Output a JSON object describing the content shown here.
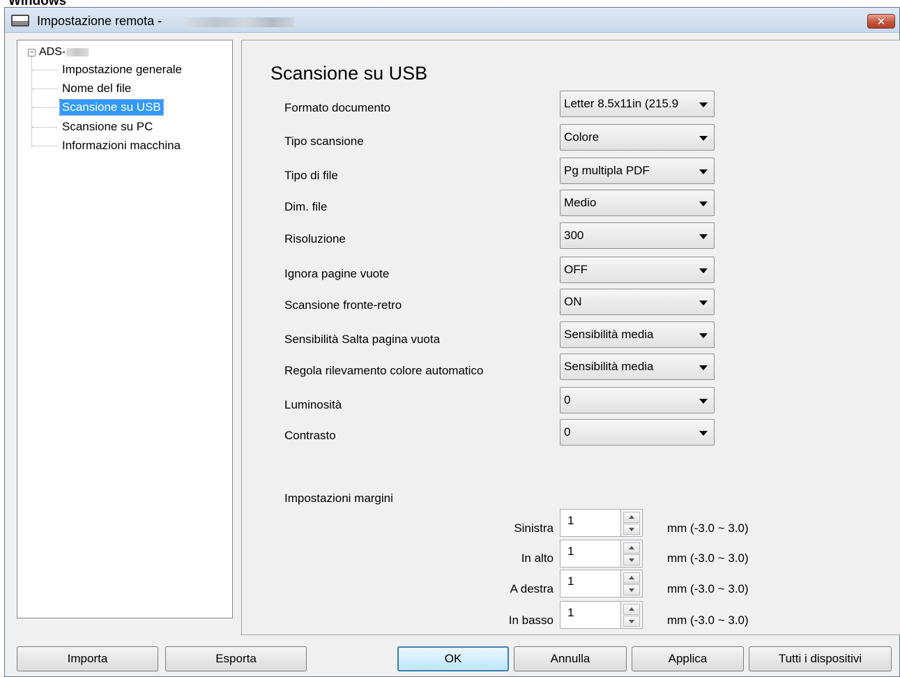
{
  "page": {
    "caption": "Windows"
  },
  "window": {
    "title": "Impostazione remota -",
    "close_icon": "close-icon"
  },
  "tree": {
    "root_label": "ADS-",
    "items": [
      {
        "label": "Impostazione generale"
      },
      {
        "label": "Nome del file"
      },
      {
        "label": "Scansione su USB",
        "selected": true
      },
      {
        "label": "Scansione su PC"
      },
      {
        "label": "Informazioni macchina"
      }
    ]
  },
  "content": {
    "title": "Scansione su USB",
    "settings": [
      {
        "label": "Formato documento",
        "value": "Letter 8.5x11in (215.9"
      },
      {
        "label": "Tipo scansione",
        "value": "Colore"
      },
      {
        "label": "Tipo di file",
        "value": "Pg multipla PDF"
      },
      {
        "label": "Dim. file",
        "value": "Medio"
      },
      {
        "label": "Risoluzione",
        "value": "300"
      },
      {
        "label": "Ignora pagine vuote",
        "value": "OFF"
      },
      {
        "label": "Scansione fronte-retro",
        "value": "ON"
      },
      {
        "label": "Sensibilità Salta pagina vuota",
        "value": "Sensibilità media"
      },
      {
        "label": "Regola rilevamento colore automatico",
        "value": "Sensibilità media"
      },
      {
        "label": "Luminosità",
        "value": "0"
      },
      {
        "label": "Contrasto",
        "value": "0"
      }
    ],
    "margins": {
      "label": "Impostazioni margini",
      "fields": [
        {
          "label": "Sinistra",
          "value": "1",
          "range": "mm (-3.0 ~ 3.0)"
        },
        {
          "label": "In alto",
          "value": "1",
          "range": "mm (-3.0 ~ 3.0)"
        },
        {
          "label": "A destra",
          "value": "1",
          "range": "mm (-3.0 ~ 3.0)"
        },
        {
          "label": "In basso",
          "value": "1",
          "range": "mm (-3.0 ~ 3.0)"
        }
      ]
    }
  },
  "buttons": {
    "import": "Importa",
    "export": "Esporta",
    "ok": "OK",
    "cancel": "Annulla",
    "apply": "Applica",
    "all_devices": "Tutti i dispositivi"
  }
}
